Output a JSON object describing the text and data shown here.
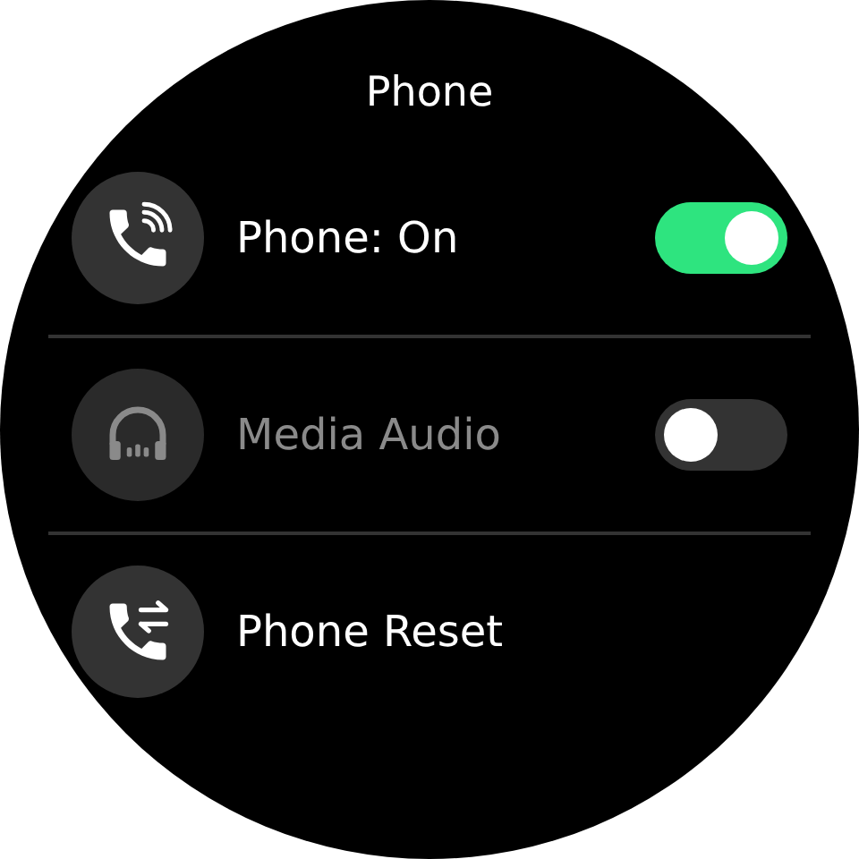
{
  "title": "Phone",
  "rows": [
    {
      "kind": "toggle",
      "label": "Phone: On",
      "on": true,
      "disabled": false
    },
    {
      "kind": "toggle",
      "label": "Media Audio",
      "on": false,
      "disabled": true
    },
    {
      "kind": "action",
      "label": "Phone Reset",
      "disabled": false
    }
  ]
}
